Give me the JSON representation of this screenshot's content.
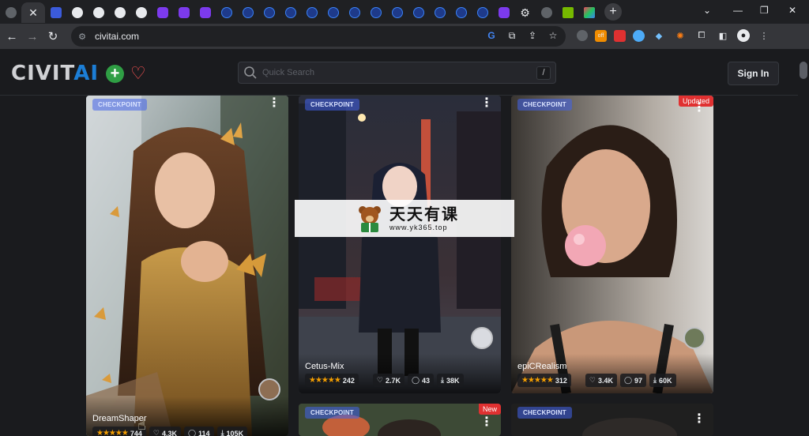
{
  "browser": {
    "tabs": [
      "globe",
      "active",
      "gh",
      "gh",
      "gh",
      "gh",
      "u",
      "u",
      "u",
      "c",
      "c",
      "c",
      "c",
      "c",
      "c",
      "c",
      "c",
      "c",
      "c",
      "c",
      "c",
      "c",
      "u",
      "gear",
      "globe",
      "nv",
      "mu"
    ],
    "active_close": "✕",
    "new_tab": "+",
    "url": "civitai.com"
  },
  "header": {
    "logo_main": "CIVIT",
    "logo_accent": "AI",
    "search_placeholder": "Quick Search",
    "search_shortcut": "/",
    "sign_in": "Sign In"
  },
  "cards": [
    {
      "type": "CHECKPOINT",
      "title": "DreamShaper",
      "rating_count": "744",
      "likes": "4.3K",
      "comments": "114",
      "downloads": "105K",
      "ribbon": ""
    },
    {
      "type": "CHECKPOINT",
      "title": "Cetus-Mix",
      "rating_count": "242",
      "likes": "2.7K",
      "comments": "43",
      "downloads": "38K",
      "ribbon": ""
    },
    {
      "type": "CHECKPOINT",
      "title": "epiCRealism",
      "rating_count": "312",
      "likes": "3.4K",
      "comments": "97",
      "downloads": "60K",
      "ribbon": "Updated"
    },
    {
      "type": "CHECKPOINT",
      "title": "",
      "ribbon": "New"
    },
    {
      "type": "CHECKPOINT",
      "title": "",
      "ribbon": ""
    }
  ],
  "watermark": {
    "title": "天天有课",
    "url": "www.yk365.top"
  },
  "icons": {
    "heart": "♡",
    "comment": "◯",
    "download": "⤓",
    "dots": "⋮",
    "star": "★"
  }
}
